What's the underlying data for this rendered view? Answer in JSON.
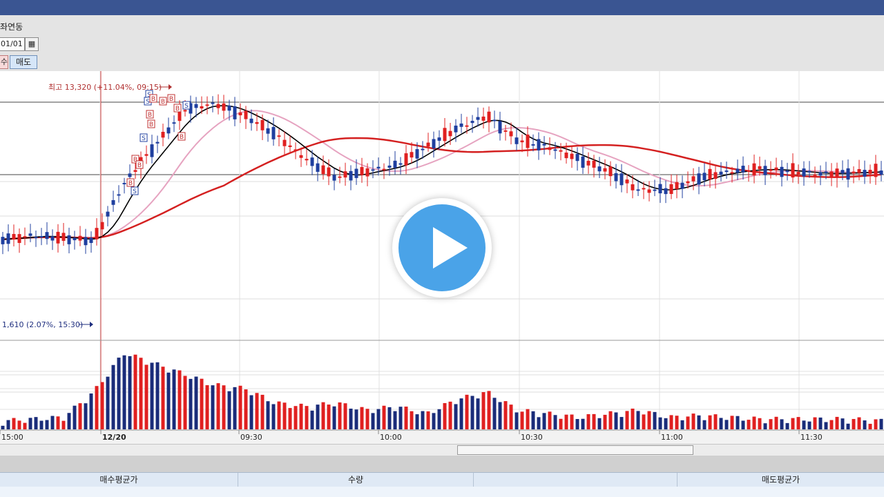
{
  "toolbar": {
    "account_label": "좌연동",
    "date_value": "01/01",
    "calendar_icon": "calendar-icon",
    "buy_tab": "수",
    "sell_tab": "매도"
  },
  "chart_data": {
    "type": "candlestick",
    "title": "",
    "annotations": {
      "high": "최고 13,320 (+11.04%, 09:15)",
      "low": "1,610 (2.07%, 15:30)"
    },
    "x_tick_labels": [
      "15:00",
      "12/20",
      "09:30",
      "10:00",
      "10:30",
      "11:00",
      "11:30"
    ],
    "trade_markers": [
      "S",
      "S",
      "B",
      "B",
      "S",
      "B",
      "B",
      "B",
      "S",
      "B",
      "B",
      "B",
      "S",
      "B",
      "B"
    ],
    "price_series_approx": [
      12150,
      12180,
      12160,
      12140,
      12600,
      12900,
      13200,
      13250,
      13150,
      13000,
      12800,
      12650,
      12700,
      12750,
      12900,
      13050,
      13150,
      12950,
      12900,
      12800,
      12700,
      12550,
      12550,
      12650,
      12700,
      12720,
      12700,
      12680,
      12690,
      12700
    ],
    "volume_series_approx": [
      2,
      3,
      4,
      18,
      40,
      34,
      28,
      22,
      20,
      12,
      10,
      12,
      8,
      10,
      6,
      14,
      18,
      8,
      6,
      4,
      6,
      8,
      4,
      5,
      4,
      3,
      3,
      3,
      3,
      2
    ],
    "series": [
      {
        "name": "",
        "color": "#000000"
      },
      {
        "name": "",
        "color": "#e6a3c0"
      },
      {
        "name": "",
        "color": "#d42020"
      }
    ],
    "colors": {
      "up": "#e02020",
      "down": "#1f3f9f",
      "volume_up": "#e02020",
      "volume_down": "#1a2c7a"
    }
  },
  "play_icon": "play-icon",
  "table": {
    "headers": [
      "매수평균가",
      "수량",
      "",
      "매도평균가"
    ]
  }
}
